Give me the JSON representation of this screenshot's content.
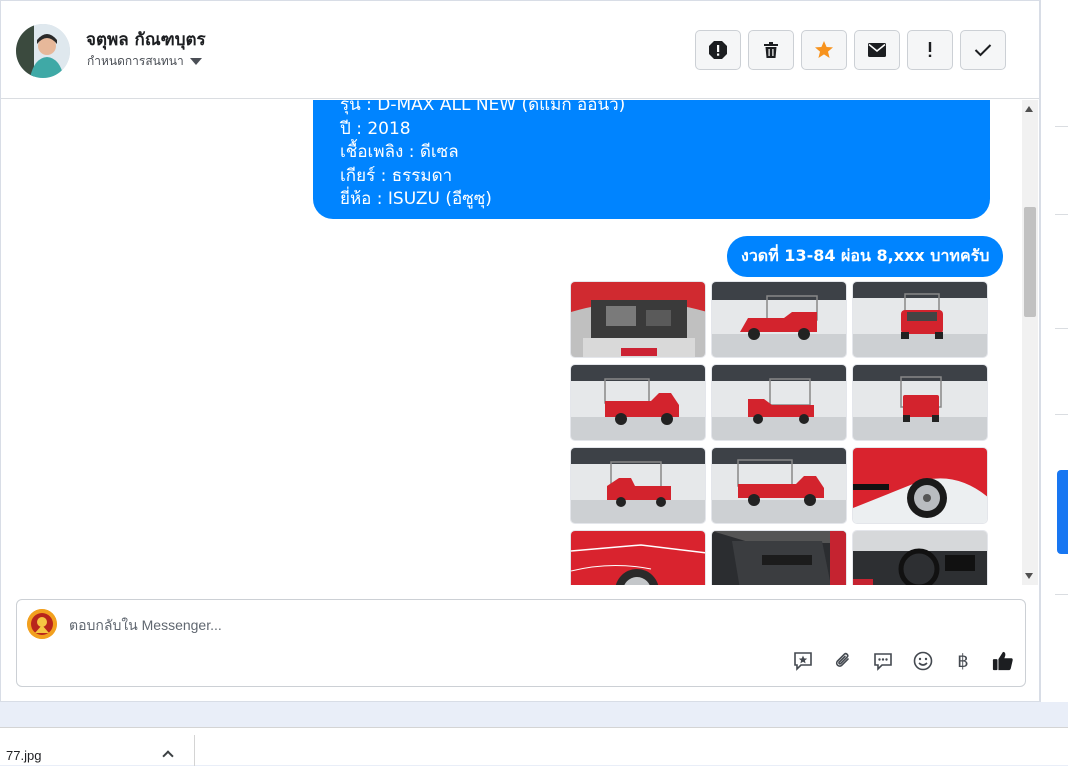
{
  "header": {
    "contact_name": "จตุพล กัณฑบุตร",
    "assign_label": "กำหนดการสนทนา",
    "actions": [
      "report-icon",
      "trash-icon",
      "star-icon",
      "envelope-icon",
      "exclamation-icon",
      "check-icon"
    ],
    "star_color": "#f7931e"
  },
  "conversation": {
    "car_details": [
      "รุ่น : D-MAX ALL NEW (ดีแม็ก ออนิว)",
      "ปี : 2018",
      "เชื้อเพลิง : ดีเซล",
      "เกียร์ : ธรรมดา",
      "ยี่ห้อ : ISUZU (อีซูซุ)"
    ],
    "installment_message": "งวดที่ 13-84 ผ่อน 8,xxx บาทครับ",
    "bubble_color": "#0084ff",
    "photos": [
      "engine-bay",
      "truck-front-left",
      "truck-front",
      "truck-side-right",
      "truck-rear-right",
      "truck-rear",
      "truck-side-left",
      "truck-side",
      "wheel-closeup",
      "rear-fender",
      "door-interior",
      "dashboard"
    ]
  },
  "composer": {
    "placeholder": "ตอบกลับใน Messenger...",
    "tools": [
      "saved-reply-icon",
      "attachment-icon",
      "chat-bubble-icon",
      "emoji-icon",
      "baht-icon",
      "thumbs-up-icon"
    ],
    "baht_symbol": "฿"
  },
  "download_bar": {
    "file_name": "77.jpg"
  }
}
